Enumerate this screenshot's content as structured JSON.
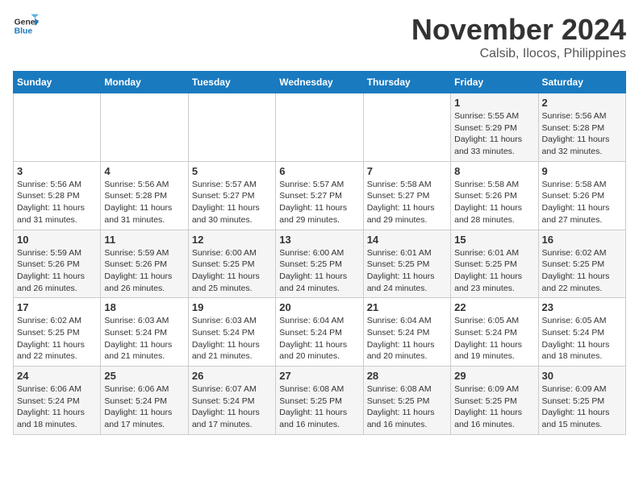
{
  "logo": {
    "line1": "General",
    "line2": "Blue"
  },
  "title": "November 2024",
  "location": "Calsib, Ilocos, Philippines",
  "days_of_week": [
    "Sunday",
    "Monday",
    "Tuesday",
    "Wednesday",
    "Thursday",
    "Friday",
    "Saturday"
  ],
  "weeks": [
    [
      {
        "day": "",
        "info": ""
      },
      {
        "day": "",
        "info": ""
      },
      {
        "day": "",
        "info": ""
      },
      {
        "day": "",
        "info": ""
      },
      {
        "day": "",
        "info": ""
      },
      {
        "day": "1",
        "info": "Sunrise: 5:55 AM\nSunset: 5:29 PM\nDaylight: 11 hours and 33 minutes."
      },
      {
        "day": "2",
        "info": "Sunrise: 5:56 AM\nSunset: 5:28 PM\nDaylight: 11 hours and 32 minutes."
      }
    ],
    [
      {
        "day": "3",
        "info": "Sunrise: 5:56 AM\nSunset: 5:28 PM\nDaylight: 11 hours and 31 minutes."
      },
      {
        "day": "4",
        "info": "Sunrise: 5:56 AM\nSunset: 5:28 PM\nDaylight: 11 hours and 31 minutes."
      },
      {
        "day": "5",
        "info": "Sunrise: 5:57 AM\nSunset: 5:27 PM\nDaylight: 11 hours and 30 minutes."
      },
      {
        "day": "6",
        "info": "Sunrise: 5:57 AM\nSunset: 5:27 PM\nDaylight: 11 hours and 29 minutes."
      },
      {
        "day": "7",
        "info": "Sunrise: 5:58 AM\nSunset: 5:27 PM\nDaylight: 11 hours and 29 minutes."
      },
      {
        "day": "8",
        "info": "Sunrise: 5:58 AM\nSunset: 5:26 PM\nDaylight: 11 hours and 28 minutes."
      },
      {
        "day": "9",
        "info": "Sunrise: 5:58 AM\nSunset: 5:26 PM\nDaylight: 11 hours and 27 minutes."
      }
    ],
    [
      {
        "day": "10",
        "info": "Sunrise: 5:59 AM\nSunset: 5:26 PM\nDaylight: 11 hours and 26 minutes."
      },
      {
        "day": "11",
        "info": "Sunrise: 5:59 AM\nSunset: 5:26 PM\nDaylight: 11 hours and 26 minutes."
      },
      {
        "day": "12",
        "info": "Sunrise: 6:00 AM\nSunset: 5:25 PM\nDaylight: 11 hours and 25 minutes."
      },
      {
        "day": "13",
        "info": "Sunrise: 6:00 AM\nSunset: 5:25 PM\nDaylight: 11 hours and 24 minutes."
      },
      {
        "day": "14",
        "info": "Sunrise: 6:01 AM\nSunset: 5:25 PM\nDaylight: 11 hours and 24 minutes."
      },
      {
        "day": "15",
        "info": "Sunrise: 6:01 AM\nSunset: 5:25 PM\nDaylight: 11 hours and 23 minutes."
      },
      {
        "day": "16",
        "info": "Sunrise: 6:02 AM\nSunset: 5:25 PM\nDaylight: 11 hours and 22 minutes."
      }
    ],
    [
      {
        "day": "17",
        "info": "Sunrise: 6:02 AM\nSunset: 5:25 PM\nDaylight: 11 hours and 22 minutes."
      },
      {
        "day": "18",
        "info": "Sunrise: 6:03 AM\nSunset: 5:24 PM\nDaylight: 11 hours and 21 minutes."
      },
      {
        "day": "19",
        "info": "Sunrise: 6:03 AM\nSunset: 5:24 PM\nDaylight: 11 hours and 21 minutes."
      },
      {
        "day": "20",
        "info": "Sunrise: 6:04 AM\nSunset: 5:24 PM\nDaylight: 11 hours and 20 minutes."
      },
      {
        "day": "21",
        "info": "Sunrise: 6:04 AM\nSunset: 5:24 PM\nDaylight: 11 hours and 20 minutes."
      },
      {
        "day": "22",
        "info": "Sunrise: 6:05 AM\nSunset: 5:24 PM\nDaylight: 11 hours and 19 minutes."
      },
      {
        "day": "23",
        "info": "Sunrise: 6:05 AM\nSunset: 5:24 PM\nDaylight: 11 hours and 18 minutes."
      }
    ],
    [
      {
        "day": "24",
        "info": "Sunrise: 6:06 AM\nSunset: 5:24 PM\nDaylight: 11 hours and 18 minutes."
      },
      {
        "day": "25",
        "info": "Sunrise: 6:06 AM\nSunset: 5:24 PM\nDaylight: 11 hours and 17 minutes."
      },
      {
        "day": "26",
        "info": "Sunrise: 6:07 AM\nSunset: 5:24 PM\nDaylight: 11 hours and 17 minutes."
      },
      {
        "day": "27",
        "info": "Sunrise: 6:08 AM\nSunset: 5:25 PM\nDaylight: 11 hours and 16 minutes."
      },
      {
        "day": "28",
        "info": "Sunrise: 6:08 AM\nSunset: 5:25 PM\nDaylight: 11 hours and 16 minutes."
      },
      {
        "day": "29",
        "info": "Sunrise: 6:09 AM\nSunset: 5:25 PM\nDaylight: 11 hours and 16 minutes."
      },
      {
        "day": "30",
        "info": "Sunrise: 6:09 AM\nSunset: 5:25 PM\nDaylight: 11 hours and 15 minutes."
      }
    ]
  ]
}
